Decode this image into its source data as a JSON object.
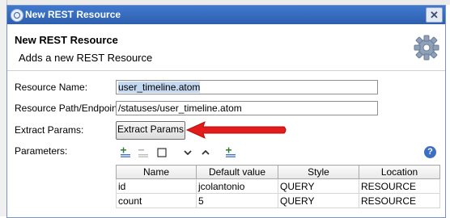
{
  "dialog": {
    "title": "New REST Resource",
    "close_glyph": "✕",
    "banner_title": "New REST Resource",
    "banner_subtitle": "Adds a new REST Resource"
  },
  "form": {
    "resource_name_label": "Resource Name:",
    "resource_name_value": "user_timeline.atom",
    "resource_path_label": "Resource Path/Endpoint:",
    "resource_path_value": "/statuses/user_timeline.atom",
    "extract_params_label": "Extract Params:",
    "extract_params_button": "Extract Params",
    "parameters_label": "Parameters:"
  },
  "toolbar": {
    "help_glyph": "?"
  },
  "table": {
    "columns": [
      "Name",
      "Default value",
      "Style",
      "Location"
    ],
    "rows": [
      [
        "id",
        "jcolantonio",
        "QUERY",
        "RESOURCE"
      ],
      [
        "count",
        "5",
        "QUERY",
        "RESOURCE"
      ]
    ]
  },
  "colors": {
    "titlebar": "#3f79cf",
    "arrow": "#e31b1b",
    "selection": "#c4d8f2"
  }
}
